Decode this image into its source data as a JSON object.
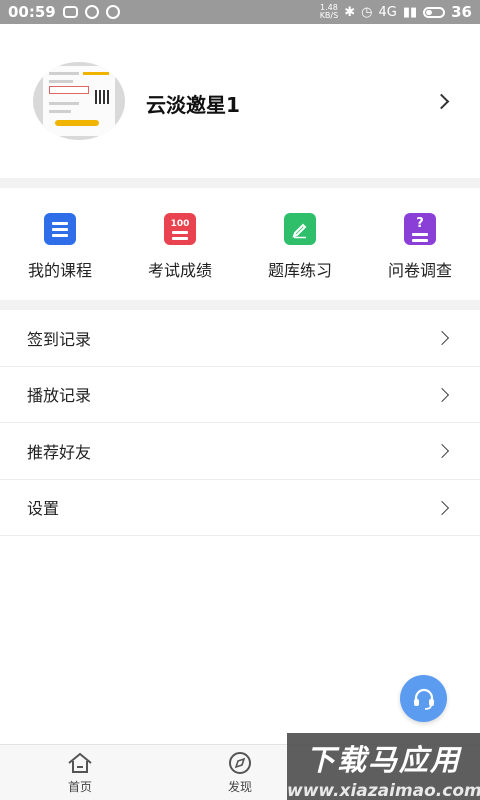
{
  "status_bar": {
    "time": "00:59",
    "net_speed_top": "1.48",
    "net_speed_bottom": "KB/S",
    "network": "4G",
    "battery": "36"
  },
  "profile": {
    "username": "云淡邀星1"
  },
  "quick_actions": [
    {
      "label": "我的课程",
      "icon": "list-icon",
      "color": "#2f6ee8"
    },
    {
      "label": "考试成绩",
      "icon": "score-100-icon",
      "badge": "100",
      "color": "#e8434f"
    },
    {
      "label": "题库练习",
      "icon": "pencil-icon",
      "color": "#2fbf6b"
    },
    {
      "label": "问卷调查",
      "icon": "question-icon",
      "badge": "?",
      "color": "#8a3fd6"
    }
  ],
  "menu": [
    {
      "label": "签到记录"
    },
    {
      "label": "播放记录"
    },
    {
      "label": "推荐好友"
    },
    {
      "label": "设置"
    }
  ],
  "tabbar": [
    {
      "label": "首页",
      "icon": "home-icon"
    },
    {
      "label": "发现",
      "icon": "compass-icon"
    }
  ],
  "watermark": {
    "title": "下载马应用",
    "url": "www.xiazaimao.com"
  },
  "fab": {
    "icon": "headset-icon",
    "color": "#5b9cf0"
  }
}
